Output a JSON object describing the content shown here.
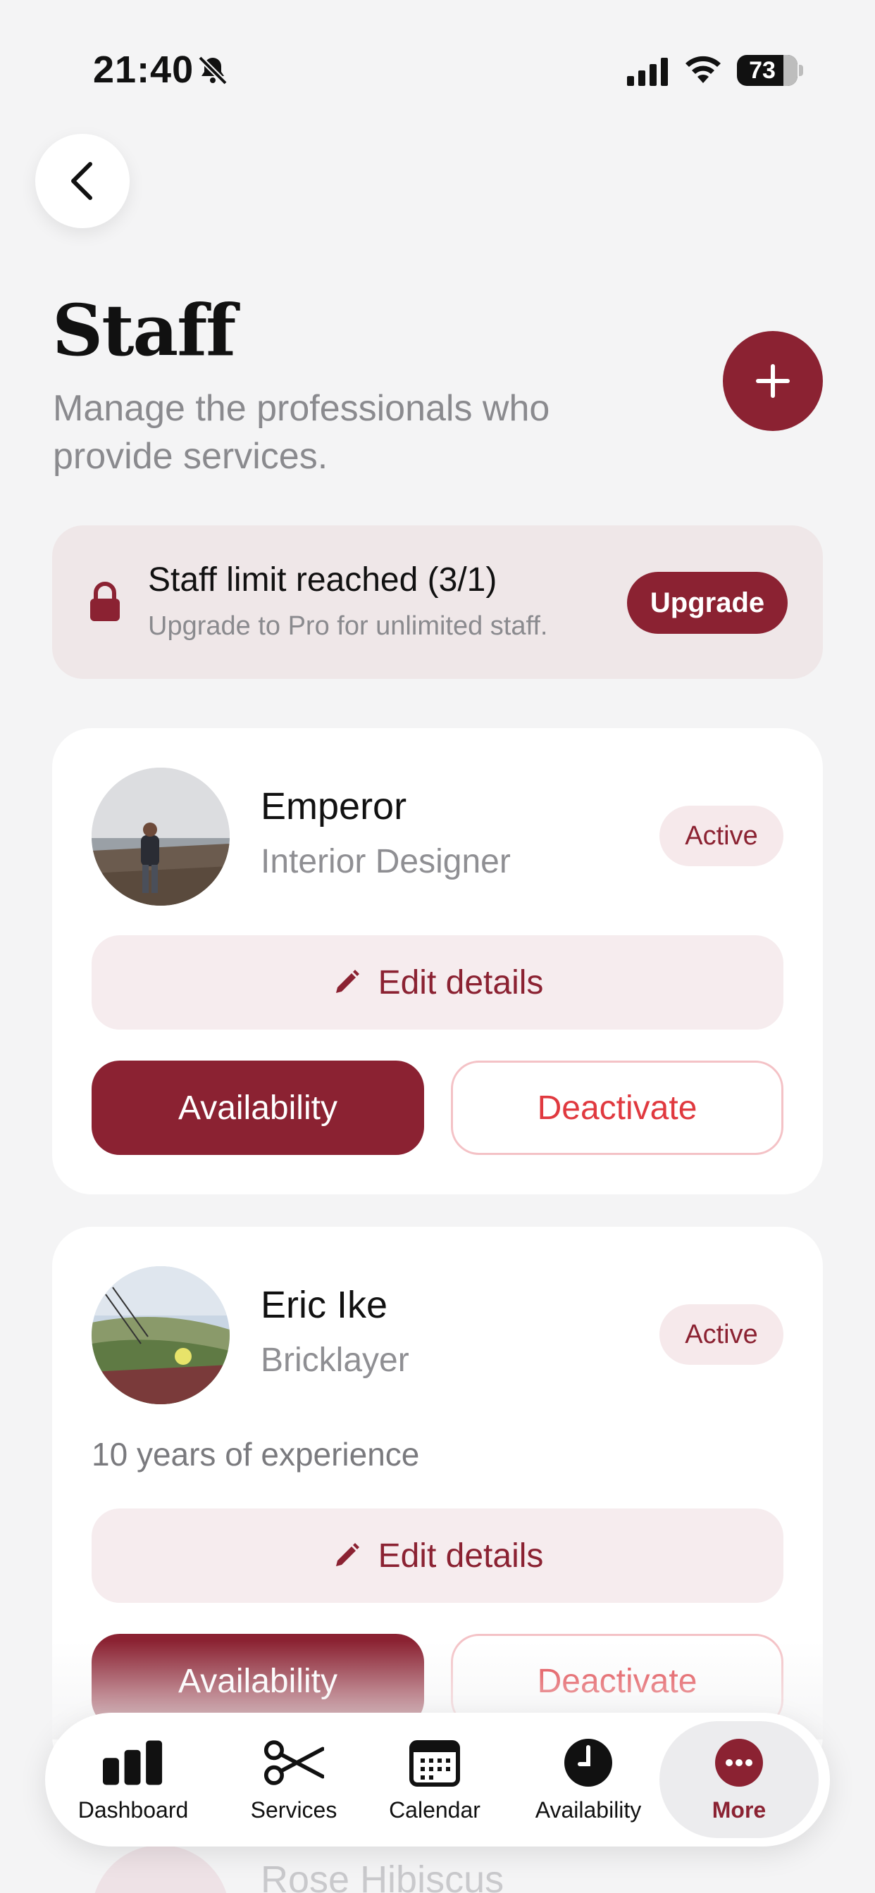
{
  "status_bar": {
    "time": "21:40",
    "battery": "73"
  },
  "header": {
    "title": "Staff",
    "subtitle": "Manage the professionals who provide services."
  },
  "limit_banner": {
    "title": "Staff limit reached (3/1)",
    "subtitle": "Upgrade to Pro for unlimited staff.",
    "button": "Upgrade"
  },
  "staff": [
    {
      "name": "Emperor",
      "role": "Interior Designer",
      "status": "Active",
      "edit_label": "Edit details",
      "availability_label": "Availability",
      "deactivate_label": "Deactivate"
    },
    {
      "name": "Eric Ike",
      "role": "Bricklayer",
      "status": "Active",
      "experience": "10 years of experience",
      "edit_label": "Edit details",
      "availability_label": "Availability",
      "deactivate_label": "Deactivate"
    },
    {
      "name": "Rose Hibiscus"
    }
  ],
  "bottom_nav": {
    "items": [
      {
        "label": "Dashboard",
        "icon": "bar-chart-icon"
      },
      {
        "label": "Services",
        "icon": "scissors-icon"
      },
      {
        "label": "Calendar",
        "icon": "calendar-icon"
      },
      {
        "label": "Availability",
        "icon": "clock-icon"
      },
      {
        "label": "More",
        "icon": "more-icon"
      }
    ]
  },
  "colors": {
    "accent": "#8b2232",
    "danger": "#e0393f",
    "background": "#f4f4f5"
  }
}
